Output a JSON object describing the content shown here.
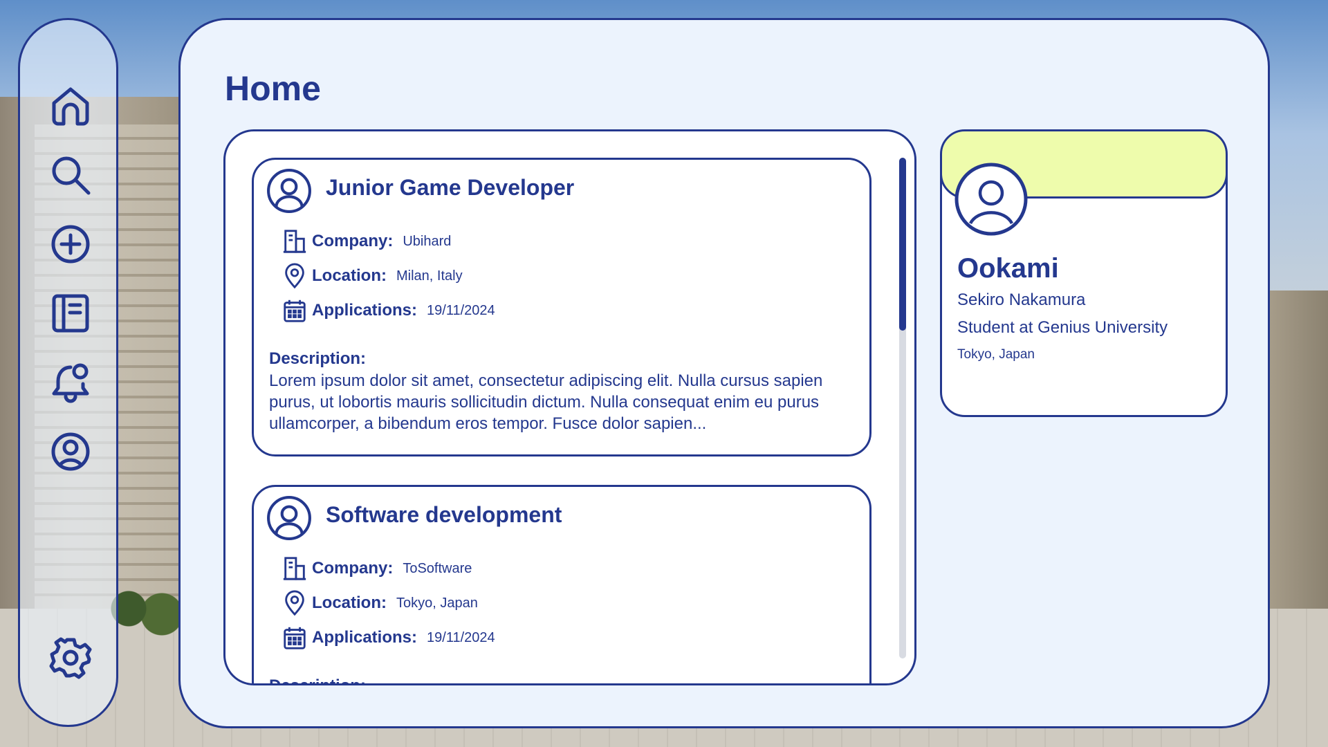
{
  "page": {
    "title": "Home"
  },
  "sidebar": {
    "items": [
      {
        "icon": "home-icon"
      },
      {
        "icon": "search-icon"
      },
      {
        "icon": "add-icon"
      },
      {
        "icon": "book-icon"
      },
      {
        "icon": "notification-bell-icon"
      },
      {
        "icon": "profile-icon"
      },
      {
        "icon": "settings-icon"
      }
    ]
  },
  "feed": {
    "labels": {
      "company": "Company:",
      "location": "Location:",
      "applications": "Applications:",
      "description": "Description:"
    },
    "jobs": [
      {
        "title": "Junior Game Developer",
        "company": "Ubihard",
        "location": "Milan, Italy",
        "applications": "19/11/2024",
        "description": "Lorem ipsum dolor sit amet, consectetur adipiscing elit. Nulla cursus sapien purus, ut lobortis mauris sollicitudin dictum. Nulla consequat enim eu purus ullamcorper, a bibendum eros tempor. Fusce dolor sapien..."
      },
      {
        "title": "Software development",
        "company": "ToSoftware",
        "location": "Tokyo, Japan",
        "applications": "19/11/2024",
        "description": ""
      }
    ]
  },
  "profile": {
    "username": "Ookami",
    "full_name": "Sekiro Nakamura",
    "role": "Student at Genius University",
    "location": "Tokyo, Japan",
    "banner_color": "#eefcac"
  },
  "colors": {
    "accent": "#24388e",
    "panel_bg": "#ecf3fd",
    "banner": "#eefcac"
  }
}
